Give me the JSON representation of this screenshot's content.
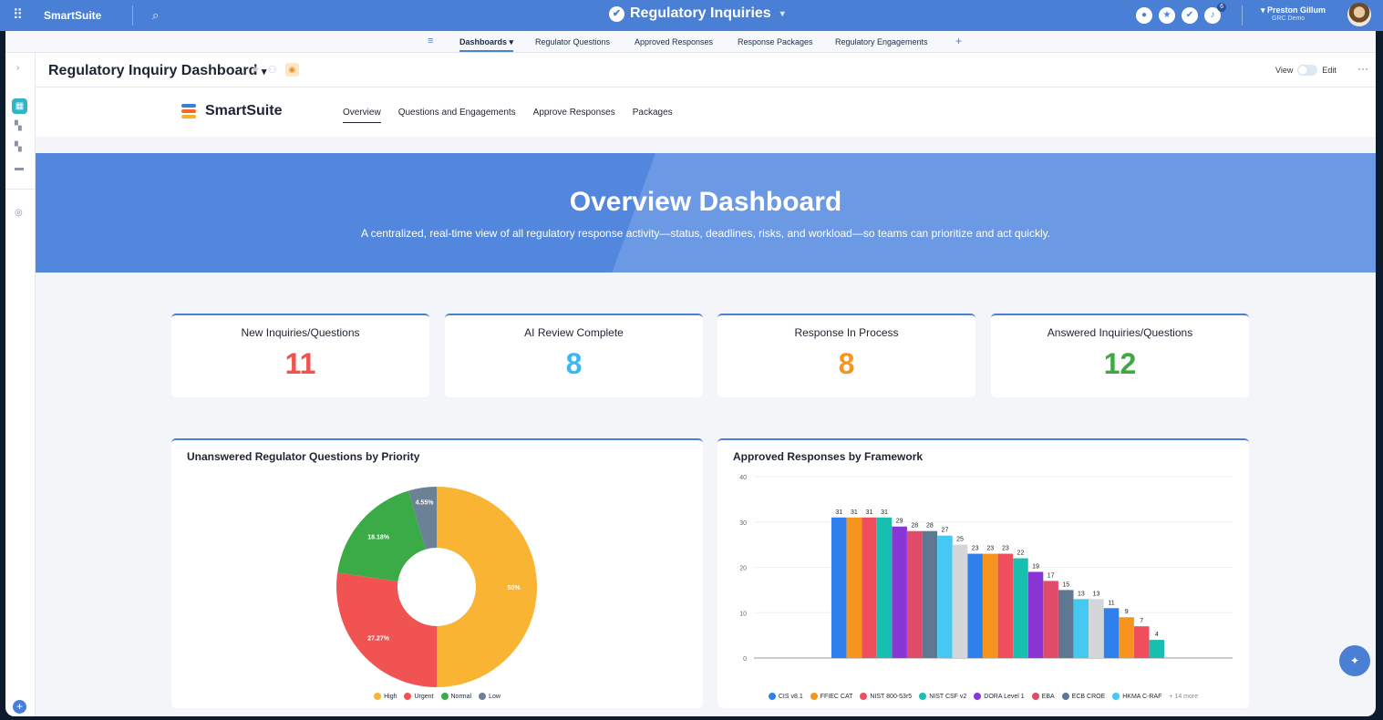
{
  "topbar": {
    "brand": "SmartSuite",
    "title": "Regulatory Inquiries",
    "notification_count": "6",
    "user_name": "Preston Gillum",
    "user_sub": "GRC Demo"
  },
  "nav_tabs": [
    "Dashboards",
    "Regulator Questions",
    "Approved Responses",
    "Response Packages",
    "Regulatory Engagements"
  ],
  "header": {
    "title": "Regulatory Inquiry Dashboard",
    "view_label": "View",
    "edit_label": "Edit"
  },
  "logo": "SmartSuite",
  "subtabs": [
    "Overview",
    "Questions and Engagements",
    "Approve Responses",
    "Packages"
  ],
  "hero": {
    "title": "Overview Dashboard",
    "subtitle": "A centralized, real-time view of all regulatory response activity—status, deadlines, risks, and workload—so teams can prioritize and act quickly."
  },
  "kpis": [
    {
      "label": "New Inquiries/Questions",
      "value": "11",
      "color": "#f0524d"
    },
    {
      "label": "AI Review Complete",
      "value": "8",
      "color": "#3ab8f0"
    },
    {
      "label": "Response In Process",
      "value": "8",
      "color": "#f7941d"
    },
    {
      "label": "Answered Inquiries/Questions",
      "value": "12",
      "color": "#3fa845"
    }
  ],
  "chart_data": [
    {
      "type": "pie",
      "title": "Unanswered Regulator Questions by Priority",
      "categories": [
        "High",
        "Urgent",
        "Normal",
        "Low"
      ],
      "values": [
        50,
        27.27,
        18.18,
        4.55
      ],
      "labels": [
        "50%",
        "27.27%",
        "18.18%",
        "4.55%"
      ],
      "colors": [
        "#f8b432",
        "#f15353",
        "#3aab47",
        "#6b8196"
      ],
      "legend": "bottom"
    },
    {
      "type": "bar",
      "title": "Approved Responses by Framework",
      "ylim": [
        0,
        40
      ],
      "yticks": [
        0,
        10,
        20,
        30,
        40
      ],
      "values": [
        31,
        31,
        31,
        31,
        29,
        28,
        28,
        27,
        25,
        23,
        23,
        23,
        22,
        19,
        17,
        15,
        13,
        13,
        11,
        9,
        7,
        4
      ],
      "colors": [
        "#2f80ed",
        "#f7941d",
        "#ef4f5c",
        "#17bfb0",
        "#8a35d6",
        "#e04b6a",
        "#5e7892",
        "#45c8f2",
        "#d4d6da",
        "#2f80ed",
        "#f7941d",
        "#ef4f5c",
        "#17bfb0",
        "#8a35d6",
        "#e04b6a",
        "#5e7892",
        "#45c8f2",
        "#d4d6da",
        "#2f80ed",
        "#f7941d",
        "#ef4f5c",
        "#17bfb0"
      ],
      "legend_items": [
        "CIS v8.1",
        "FFIEC CAT",
        "NIST 800-53r5",
        "NIST CSF v2",
        "DORA Level 1",
        "EBA",
        "ECB CROE",
        "HKMA C-RAF"
      ],
      "legend_more": "+ 14 more",
      "legend": "bottom"
    }
  ]
}
